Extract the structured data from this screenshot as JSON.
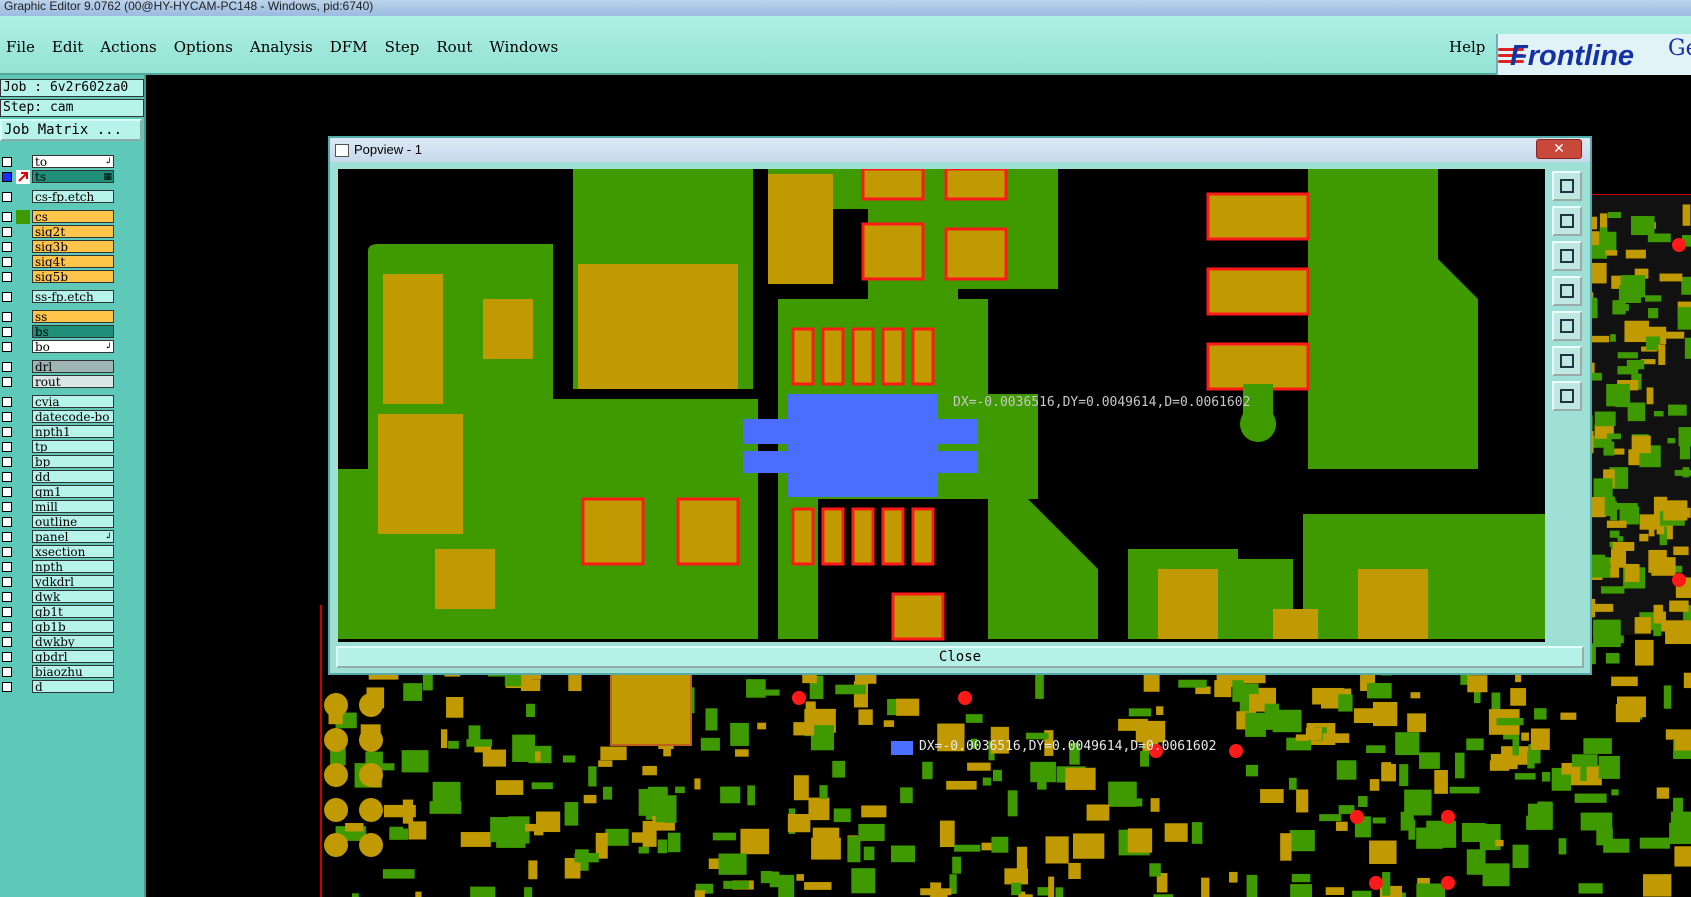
{
  "window": {
    "title": "Graphic Editor 9.0762 (00@HY-HYCAM-PC148 - Windows, pid:6740)"
  },
  "menu": {
    "items": [
      "File",
      "Edit",
      "Actions",
      "Options",
      "Analysis",
      "DFM",
      "Step",
      "Rout",
      "Windows"
    ],
    "help": "Help"
  },
  "brand": {
    "logo": "Frontline",
    "suffix": "Ge",
    "color": "#1432a6"
  },
  "job": {
    "job_line": "Job : 6v2r602za0",
    "step_line": "Step: cam",
    "matrix_button": "Job Matrix ..."
  },
  "layers": [
    {
      "name": "to",
      "bg": "#ffffff",
      "arrow": "↲"
    },
    {
      "name": "ts",
      "bg": "#1f8f7a",
      "arrow": "▦"
    },
    {
      "name": "cs-fp.etch",
      "bg": "#b6f3ea",
      "arrow": ""
    },
    {
      "name": "cs",
      "bg": "#ffc44a",
      "arrow": ""
    },
    {
      "name": "sig2t",
      "bg": "#ffc44a",
      "arrow": ""
    },
    {
      "name": "sig3b",
      "bg": "#ffc44a",
      "arrow": ""
    },
    {
      "name": "sig4t",
      "bg": "#ffc44a",
      "arrow": ""
    },
    {
      "name": "sig5b",
      "bg": "#ffc44a",
      "arrow": ""
    },
    {
      "name": "ss-fp.etch",
      "bg": "#b6f3ea",
      "arrow": ""
    },
    {
      "name": "ss",
      "bg": "#ffc44a",
      "arrow": ""
    },
    {
      "name": "bs",
      "bg": "#1f8f7a",
      "arrow": ""
    },
    {
      "name": "bo",
      "bg": "#ffffff",
      "arrow": "↲"
    },
    {
      "name": "drl",
      "bg": "#9fb5b4",
      "arrow": ""
    },
    {
      "name": "rout",
      "bg": "#d8e6e4",
      "arrow": ""
    },
    {
      "name": "cvia",
      "bg": "#b6f3ea",
      "arrow": ""
    },
    {
      "name": "datecode-bo",
      "bg": "#b6f3ea",
      "arrow": ""
    },
    {
      "name": "npth1",
      "bg": "#b6f3ea",
      "arrow": ""
    },
    {
      "name": "tp",
      "bg": "#b6f3ea",
      "arrow": ""
    },
    {
      "name": "bp",
      "bg": "#b6f3ea",
      "arrow": ""
    },
    {
      "name": "dd",
      "bg": "#b6f3ea",
      "arrow": ""
    },
    {
      "name": "gm1",
      "bg": "#b6f3ea",
      "arrow": ""
    },
    {
      "name": "mill",
      "bg": "#b6f3ea",
      "arrow": ""
    },
    {
      "name": "outline",
      "bg": "#b6f3ea",
      "arrow": ""
    },
    {
      "name": "panel",
      "bg": "#b6f3ea",
      "arrow": "↲"
    },
    {
      "name": "xsection",
      "bg": "#b6f3ea",
      "arrow": ""
    },
    {
      "name": "npth",
      "bg": "#b6f3ea",
      "arrow": ""
    },
    {
      "name": "ydkdrl",
      "bg": "#b6f3ea",
      "arrow": ""
    },
    {
      "name": "dwk",
      "bg": "#b6f3ea",
      "arrow": ""
    },
    {
      "name": "gb1t",
      "bg": "#b6f3ea",
      "arrow": ""
    },
    {
      "name": "gb1b",
      "bg": "#b6f3ea",
      "arrow": ""
    },
    {
      "name": "dwkby",
      "bg": "#b6f3ea",
      "arrow": ""
    },
    {
      "name": "gbdrl",
      "bg": "#b6f3ea",
      "arrow": ""
    },
    {
      "name": "biaozhu",
      "bg": "#b6f3ea",
      "arrow": ""
    },
    {
      "name": "d",
      "bg": "#b6f3ea",
      "arrow": ""
    }
  ],
  "popview": {
    "title": "Popview - 1",
    "close_x": "✕",
    "close_button": "Close",
    "measure": "DX=-0.0036516,DY=0.0049614,D=0.0061602"
  },
  "canvas": {
    "measure": "DX=-0.0036516,DY=0.0049614,D=0.0061602"
  },
  "colors": {
    "copper": "#3f9a00",
    "pad": "#c09a00",
    "pad_outline": "#ff1a1a",
    "highlight": "#4a6fff"
  }
}
